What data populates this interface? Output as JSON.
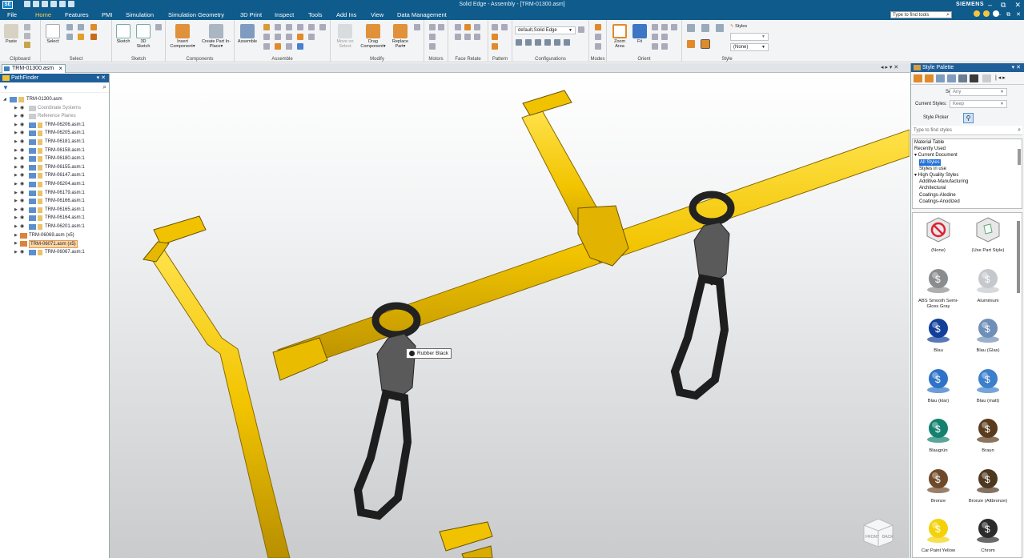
{
  "window": {
    "app_icon": "SE",
    "title": "Solid Edge - Assembly - [TRM-01300.asm]",
    "brand": "SIEMENS",
    "controls": [
      "–",
      "⧉",
      "✕"
    ]
  },
  "menu": {
    "tabs": [
      "File",
      "Home",
      "Features",
      "PMI",
      "Simulation",
      "Simulation Geometry",
      "3D Print",
      "Inspect",
      "Tools",
      "Add Ins",
      "View",
      "Data Management"
    ],
    "active_tab": "Home",
    "find_tools_placeholder": "Type to find tools"
  },
  "ribbon": {
    "groups": [
      {
        "label": "Clipboard",
        "buttons": [
          "Paste"
        ]
      },
      {
        "label": "Select",
        "buttons": [
          "Select"
        ]
      },
      {
        "label": "Sketch",
        "buttons": [
          "Sketch",
          "3D Sketch"
        ]
      },
      {
        "label": "Components",
        "buttons": [
          "Insert Component▾",
          "Create Part In-Place▾"
        ]
      },
      {
        "label": "Assemble",
        "buttons": [
          "Assemble"
        ]
      },
      {
        "label": "Modify",
        "buttons": [
          "Move on Select",
          "Drag Component▾",
          "Replace Part▾"
        ]
      },
      {
        "label": "Motors",
        "buttons": []
      },
      {
        "label": "Face Relate",
        "buttons": []
      },
      {
        "label": "Pattern",
        "buttons": []
      },
      {
        "label": "Configurations",
        "buttons": []
      },
      {
        "label": "Modes",
        "buttons": []
      },
      {
        "label": "Orient",
        "buttons": [
          "Zoom Area",
          "Fit"
        ]
      },
      {
        "label": "Style",
        "buttons": [
          "Styles"
        ]
      }
    ],
    "config_combo": "default,Solid Edge",
    "style_combo_value": "(None)"
  },
  "document_tab": {
    "label": "TRM-01300.asm",
    "nav": "◂ ▸ ▾ ✕"
  },
  "pathfinder": {
    "title": "PathFinder",
    "root": "TRM-01300.asm",
    "items": [
      {
        "label": "Coordinate Systems",
        "kind": "system",
        "selected": false
      },
      {
        "label": "Reference Planes",
        "kind": "system",
        "selected": false
      },
      {
        "label": "TRM-06206.asm:1",
        "kind": "asm",
        "selected": false
      },
      {
        "label": "TRM-06205.asm:1",
        "kind": "asm",
        "selected": false
      },
      {
        "label": "TRM-06181.asm:1",
        "kind": "asm",
        "selected": false
      },
      {
        "label": "TRM-06158.asm:1",
        "kind": "asm",
        "selected": false
      },
      {
        "label": "TRM-06180.asm:1",
        "kind": "asm",
        "selected": false
      },
      {
        "label": "TRM-06155.asm:1",
        "kind": "asm",
        "selected": false
      },
      {
        "label": "TRM-06147.asm:1",
        "kind": "asm",
        "selected": false
      },
      {
        "label": "TRM-06204.asm:1",
        "kind": "asm",
        "selected": false
      },
      {
        "label": "TRM-06179.asm:1",
        "kind": "asm",
        "selected": false
      },
      {
        "label": "TRM-06166.asm:1",
        "kind": "asm",
        "selected": false
      },
      {
        "label": "TRM-06165.asm:1",
        "kind": "asm",
        "selected": false
      },
      {
        "label": "TRM-06164.asm:1",
        "kind": "asm",
        "selected": false
      },
      {
        "label": "TRM-06201.asm:1",
        "kind": "asm",
        "selected": false
      },
      {
        "label": "TRM-06069.asm (x5)",
        "kind": "pattern",
        "selected": false
      },
      {
        "label": "TRM-06071.asm (x5)",
        "kind": "pattern",
        "selected": true
      },
      {
        "label": "TRM-06067.asm:1",
        "kind": "asm",
        "selected": false
      }
    ]
  },
  "viewport": {
    "tooltip": "Rubber Black",
    "viewcube": {
      "front": "FRONT",
      "back": "BACK"
    }
  },
  "style_palette": {
    "title": "Style Palette",
    "select_label": "Select:",
    "select_value": "Any",
    "current_styles_label": "Current Styles:",
    "current_styles_value": "Keep",
    "style_picker_label": "Style Picker",
    "find_placeholder": "Type to find styles",
    "list": [
      {
        "label": "Material Table",
        "indent": 0,
        "highlight": false
      },
      {
        "label": "Recently Used",
        "indent": 0,
        "highlight": false
      },
      {
        "label": "▾ Current Document",
        "indent": 0,
        "highlight": false
      },
      {
        "label": "All Styles",
        "indent": 1,
        "highlight": true
      },
      {
        "label": "Styles in use",
        "indent": 1,
        "highlight": false
      },
      {
        "label": "▾ High Quality Styles",
        "indent": 0,
        "highlight": false
      },
      {
        "label": "Additive-Manufacturing",
        "indent": 1,
        "highlight": false
      },
      {
        "label": "Architectural",
        "indent": 1,
        "highlight": false
      },
      {
        "label": "Coatings-Alodine",
        "indent": 1,
        "highlight": false
      },
      {
        "label": "Coatings-Anodized",
        "indent": 1,
        "highlight": false
      }
    ],
    "swatches": [
      {
        "label": "(None)",
        "color": "none"
      },
      {
        "label": "(Use Part Style)",
        "color": "part"
      },
      {
        "label": "ABS Smooth Semi-Gloss Gray",
        "color": "#8a8d90"
      },
      {
        "label": "Aluminium",
        "color": "#c5c8cc"
      },
      {
        "label": "Blau",
        "color": "#123f9a"
      },
      {
        "label": "Blau (Glas)",
        "color": "#6f8fb8"
      },
      {
        "label": "Blau (klar)",
        "color": "#2f73c8"
      },
      {
        "label": "Blau (matt)",
        "color": "#3c7fcc"
      },
      {
        "label": "Blaugrün",
        "color": "#14806e"
      },
      {
        "label": "Braun",
        "color": "#5a3b1e"
      },
      {
        "label": "Bronze",
        "color": "#6f4a2a"
      },
      {
        "label": "Bronze (Altbronze)",
        "color": "#4e3820"
      },
      {
        "label": "Car Paint Yellow",
        "color": "#f4d20a"
      },
      {
        "label": "Chrom",
        "color": "#2b2b2b"
      }
    ]
  },
  "colors": {
    "title_blue": "#0e5b8c",
    "accent_yellow": "#ffd24a",
    "tube_yellow": "#f2c400",
    "strap_black": "#222222"
  }
}
